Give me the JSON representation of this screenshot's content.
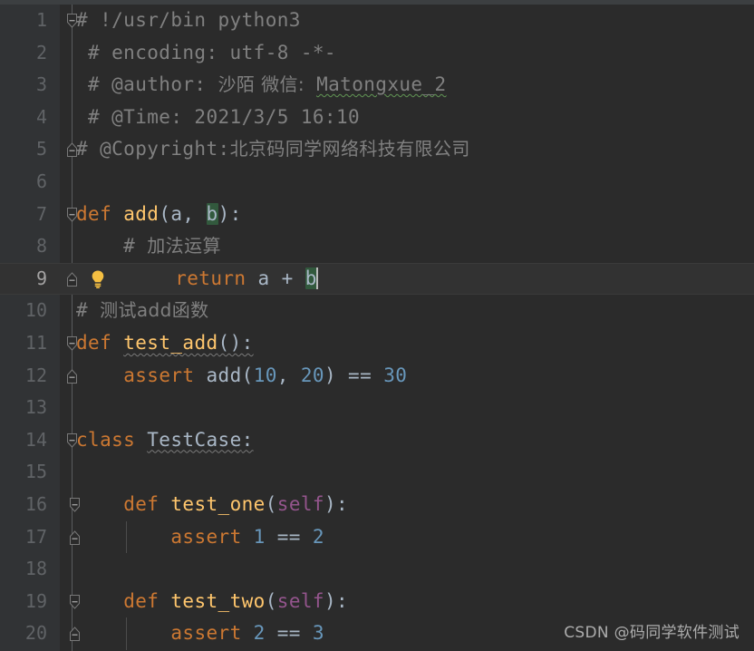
{
  "app": {
    "kind": "code-editor",
    "language": "Python",
    "theme": "Darcula",
    "colors": {
      "editor_background": "#2b2b2b",
      "gutter_background": "#313335",
      "current_line_background": "#323232",
      "top_strip": "#3c3f41",
      "line_number": "#606366",
      "line_number_active": "#a4a3a3",
      "default_text": "#a9b7c6",
      "comment": "#808080",
      "keyword": "#cc7832",
      "function_name": "#ffc66d",
      "number": "#6897bb",
      "self_keyword": "#94558d",
      "occurrence_highlight": "#32593d",
      "caret": "#bbbbbb",
      "spellcheck_squiggle": "#629755",
      "warning_squiggle": "#7a7a7a",
      "fold_rail": "#5a5c5e",
      "indent_guide": "#4b4b4b",
      "bulb": "#f5bf42"
    }
  },
  "editor": {
    "caret_line": 9,
    "caret_column_label": "after b",
    "gutter": {
      "first_line": 1,
      "last_line": 20,
      "fold_icon_collapse": "fold-collapse-icon",
      "fold_icon_end": "fold-end-icon"
    },
    "intention_bulb": {
      "icon": "lightbulb-icon",
      "line": 9
    },
    "lines": [
      {
        "n": 1,
        "fold": "collapse",
        "fold_level": 0,
        "tokens": [
          {
            "text": "# !/usr/bin python3",
            "cls": "t-comment"
          }
        ]
      },
      {
        "n": 2,
        "tokens": [
          {
            "text": " # encoding: utf-8 -*-",
            "cls": "t-comment"
          }
        ]
      },
      {
        "n": 3,
        "tokens": [
          {
            "text": " # @author: ",
            "cls": "t-comment"
          },
          {
            "text": "沙陌 微信:",
            "cls": "t-comment cjk"
          },
          {
            "text": " ",
            "cls": "t-comment"
          },
          {
            "text": "Matongxue_2",
            "cls": "t-comment sq-green"
          }
        ]
      },
      {
        "n": 4,
        "tokens": [
          {
            "text": " # @Time: 2021/3/5 16:10",
            "cls": "t-comment"
          }
        ]
      },
      {
        "n": 5,
        "fold": "end",
        "fold_level": 0,
        "tokens": [
          {
            "text": "# @Copyright:",
            "cls": "t-comment"
          },
          {
            "text": "北京码同学网络科技有限公司",
            "cls": "t-comment cjk"
          }
        ]
      },
      {
        "n": 6,
        "tokens": []
      },
      {
        "n": 7,
        "fold": "collapse",
        "fold_level": 0,
        "tokens": [
          {
            "text": "def ",
            "cls": "t-kw"
          },
          {
            "text": "add",
            "cls": "t-fn"
          },
          {
            "text": "(",
            "cls": "t-plain"
          },
          {
            "text": "a",
            "cls": "t-param"
          },
          {
            "text": ", ",
            "cls": "t-plain"
          },
          {
            "text": "b",
            "cls": "t-param occ"
          },
          {
            "text": "):",
            "cls": "t-plain"
          }
        ]
      },
      {
        "n": 8,
        "tokens": [
          {
            "text": "    # ",
            "cls": "t-comment"
          },
          {
            "text": "加法运算",
            "cls": "t-comment cjk"
          }
        ]
      },
      {
        "n": 9,
        "current": true,
        "fold": "end",
        "fold_level": 0,
        "bulb": true,
        "indent": 0,
        "tokens": [
          {
            "text": "    ",
            "cls": "t-plain"
          },
          {
            "text": "return ",
            "cls": "t-kw"
          },
          {
            "text": "a",
            "cls": "t-param"
          },
          {
            "text": " + ",
            "cls": "t-op"
          },
          {
            "text": "b",
            "cls": "t-param occ"
          },
          {
            "caret": true
          }
        ]
      },
      {
        "n": 10,
        "tokens": [
          {
            "text": "# ",
            "cls": "t-comment"
          },
          {
            "text": "测试add函数",
            "cls": "t-comment cjk"
          }
        ]
      },
      {
        "n": 11,
        "fold": "collapse",
        "fold_level": 0,
        "tokens": [
          {
            "text": "def ",
            "cls": "t-kw"
          },
          {
            "text": "test_add",
            "cls": "t-fn sq-gray"
          },
          {
            "text": "():",
            "cls": "t-plain sq-gray"
          }
        ]
      },
      {
        "n": 12,
        "fold": "end",
        "fold_level": 0,
        "tokens": [
          {
            "text": "    ",
            "cls": "t-plain"
          },
          {
            "text": "assert ",
            "cls": "t-kw"
          },
          {
            "text": "add",
            "cls": "t-plain"
          },
          {
            "text": "(",
            "cls": "t-plain"
          },
          {
            "text": "10",
            "cls": "t-num"
          },
          {
            "text": ", ",
            "cls": "t-plain"
          },
          {
            "text": "20",
            "cls": "t-num"
          },
          {
            "text": ") == ",
            "cls": "t-plain"
          },
          {
            "text": "30",
            "cls": "t-num"
          }
        ]
      },
      {
        "n": 13,
        "tokens": []
      },
      {
        "n": 14,
        "fold": "collapse",
        "fold_level": 0,
        "tokens": [
          {
            "text": "class ",
            "cls": "t-kw"
          },
          {
            "text": "TestCase",
            "cls": "t-cls sq-gray"
          },
          {
            "text": ":",
            "cls": "t-plain sq-gray"
          }
        ]
      },
      {
        "n": 15,
        "tokens": []
      },
      {
        "n": 16,
        "fold": "collapse",
        "fold_level": 1,
        "tokens": [
          {
            "text": "    ",
            "cls": "t-plain"
          },
          {
            "text": "def ",
            "cls": "t-kw"
          },
          {
            "text": "test_one",
            "cls": "t-fn"
          },
          {
            "text": "(",
            "cls": "t-plain"
          },
          {
            "text": "self",
            "cls": "t-self"
          },
          {
            "text": "):",
            "cls": "t-plain"
          }
        ]
      },
      {
        "n": 17,
        "fold": "end",
        "fold_level": 1,
        "guide": true,
        "tokens": [
          {
            "text": "        ",
            "cls": "t-plain"
          },
          {
            "text": "assert ",
            "cls": "t-kw"
          },
          {
            "text": "1",
            "cls": "t-num"
          },
          {
            "text": " == ",
            "cls": "t-plain"
          },
          {
            "text": "2",
            "cls": "t-num"
          }
        ]
      },
      {
        "n": 18,
        "tokens": []
      },
      {
        "n": 19,
        "fold": "collapse",
        "fold_level": 1,
        "tokens": [
          {
            "text": "    ",
            "cls": "t-plain"
          },
          {
            "text": "def ",
            "cls": "t-kw"
          },
          {
            "text": "test_two",
            "cls": "t-fn"
          },
          {
            "text": "(",
            "cls": "t-plain"
          },
          {
            "text": "self",
            "cls": "t-self"
          },
          {
            "text": "):",
            "cls": "t-plain"
          }
        ]
      },
      {
        "n": 20,
        "fold": "end",
        "fold_level": 1,
        "guide": true,
        "tokens": [
          {
            "text": "        ",
            "cls": "t-plain"
          },
          {
            "text": "assert ",
            "cls": "t-kw"
          },
          {
            "text": "2",
            "cls": "t-num"
          },
          {
            "text": " == ",
            "cls": "t-plain"
          },
          {
            "text": "3",
            "cls": "t-num"
          }
        ]
      }
    ]
  },
  "watermark": {
    "text": "CSDN @码同学软件测试"
  }
}
